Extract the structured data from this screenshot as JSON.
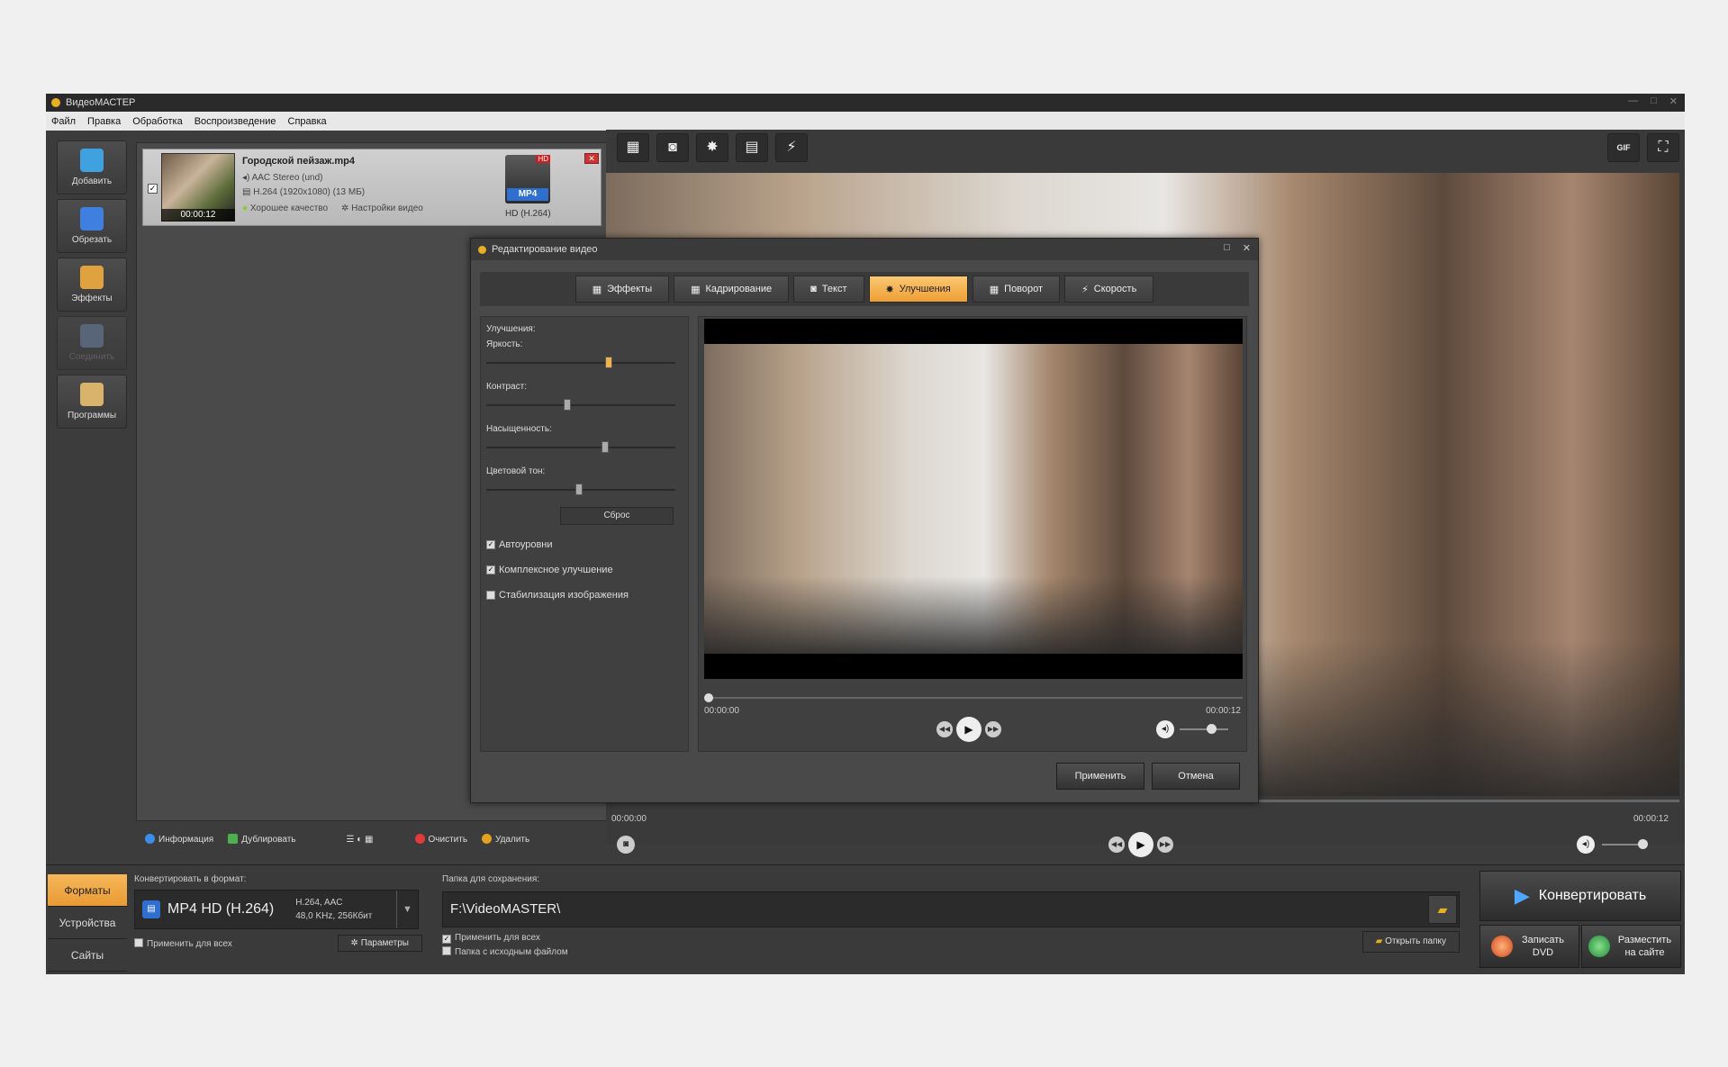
{
  "window": {
    "title": "ВидеоМАСТЕР",
    "min": "—",
    "max": "□",
    "close": "✕"
  },
  "menu": [
    "Файл",
    "Правка",
    "Обработка",
    "Воспроизведение",
    "Справка"
  ],
  "sidebar": [
    {
      "label": "Добавить",
      "icon": "add-film-icon",
      "color": "#3fa1e0",
      "disabled": false
    },
    {
      "label": "Обрезать",
      "icon": "cut-icon",
      "color": "#3f7fe0",
      "disabled": false
    },
    {
      "label": "Эффекты",
      "icon": "effects-icon",
      "color": "#e0a23f",
      "disabled": false
    },
    {
      "label": "Соединить",
      "icon": "join-icon",
      "color": "#6c7fa0",
      "disabled": true
    },
    {
      "label": "Программы",
      "icon": "programs-icon",
      "color": "#d9b26b",
      "disabled": false
    }
  ],
  "file": {
    "name": "Городской пейзаж.mp4",
    "audio": "AAC Stereo (und)",
    "video": "H.264 (1920x1080) (13 МБ)",
    "quality": "Хорошее качество",
    "settings": "Настройки видео",
    "duration": "00:00:12",
    "format_badge": "MP4",
    "hd_badge": "HD",
    "format_label": "HD (H.264)",
    "checked": "✓",
    "close": "✕"
  },
  "file_actions": {
    "info": "Информация",
    "duplicate": "Дублировать",
    "clear": "Очистить",
    "delete": "Удалить"
  },
  "preview": {
    "start": "00:00:00",
    "end": "00:00:12",
    "gif": "GIF"
  },
  "toolbar_icons": [
    "crop-icon",
    "enhance-icon",
    "brightness-icon",
    "film-icon",
    "speed-icon"
  ],
  "bottom": {
    "tabs": [
      "Форматы",
      "Устройства",
      "Сайты"
    ],
    "convert_to": "Конвертировать в формат:",
    "format_name": "MP4 HD (H.264)",
    "format_codec": "H.264, AAC",
    "format_audio": "48,0 KHz, 256Кбит",
    "apply_all": "Применить для всех",
    "params": "Параметры",
    "folder_label": "Папка для сохранения:",
    "folder_path": "F:\\VideoMASTER\\",
    "folder_apply_all": "Применить для всех",
    "source_folder": "Папка с исходным файлом",
    "open_folder": "Открыть папку",
    "convert": "Конвертировать",
    "burn_dvd": "Записать DVD",
    "publish": "Разместить на сайте"
  },
  "dialog": {
    "title": "Редактирование видео",
    "tabs": [
      {
        "label": "Эффекты",
        "icon": "effects-tab-icon",
        "glyph": "▦",
        "active": false
      },
      {
        "label": "Кадрирование",
        "icon": "crop-tab-icon",
        "glyph": "▦",
        "active": false
      },
      {
        "label": "Текст",
        "icon": "text-tab-icon",
        "glyph": "◙",
        "active": false
      },
      {
        "label": "Улучшения",
        "icon": "enhance-tab-icon",
        "glyph": "✸",
        "active": true
      },
      {
        "label": "Поворот",
        "icon": "rotate-tab-icon",
        "glyph": "▦",
        "active": false
      },
      {
        "label": "Скорость",
        "icon": "speed-tab-icon",
        "glyph": "⚡",
        "active": false
      }
    ],
    "section": "Улучшения:",
    "sliders": [
      {
        "label": "Яркость:",
        "value": 0.63,
        "hot": true
      },
      {
        "label": "Контраст:",
        "value": 0.41,
        "hot": false
      },
      {
        "label": "Насыщенность:",
        "value": 0.61,
        "hot": false
      },
      {
        "label": "Цветовой тон:",
        "value": 0.47,
        "hot": false
      }
    ],
    "reset": "Сброс",
    "checkboxes": [
      {
        "label": "Автоуровни",
        "checked": true
      },
      {
        "label": "Комплексное улучшение",
        "checked": true
      },
      {
        "label": "Стабилизация изображения",
        "checked": false
      }
    ],
    "start": "00:00:00",
    "end": "00:00:12",
    "apply": "Применить",
    "cancel": "Отмена",
    "maximize": "□",
    "close": "✕"
  }
}
